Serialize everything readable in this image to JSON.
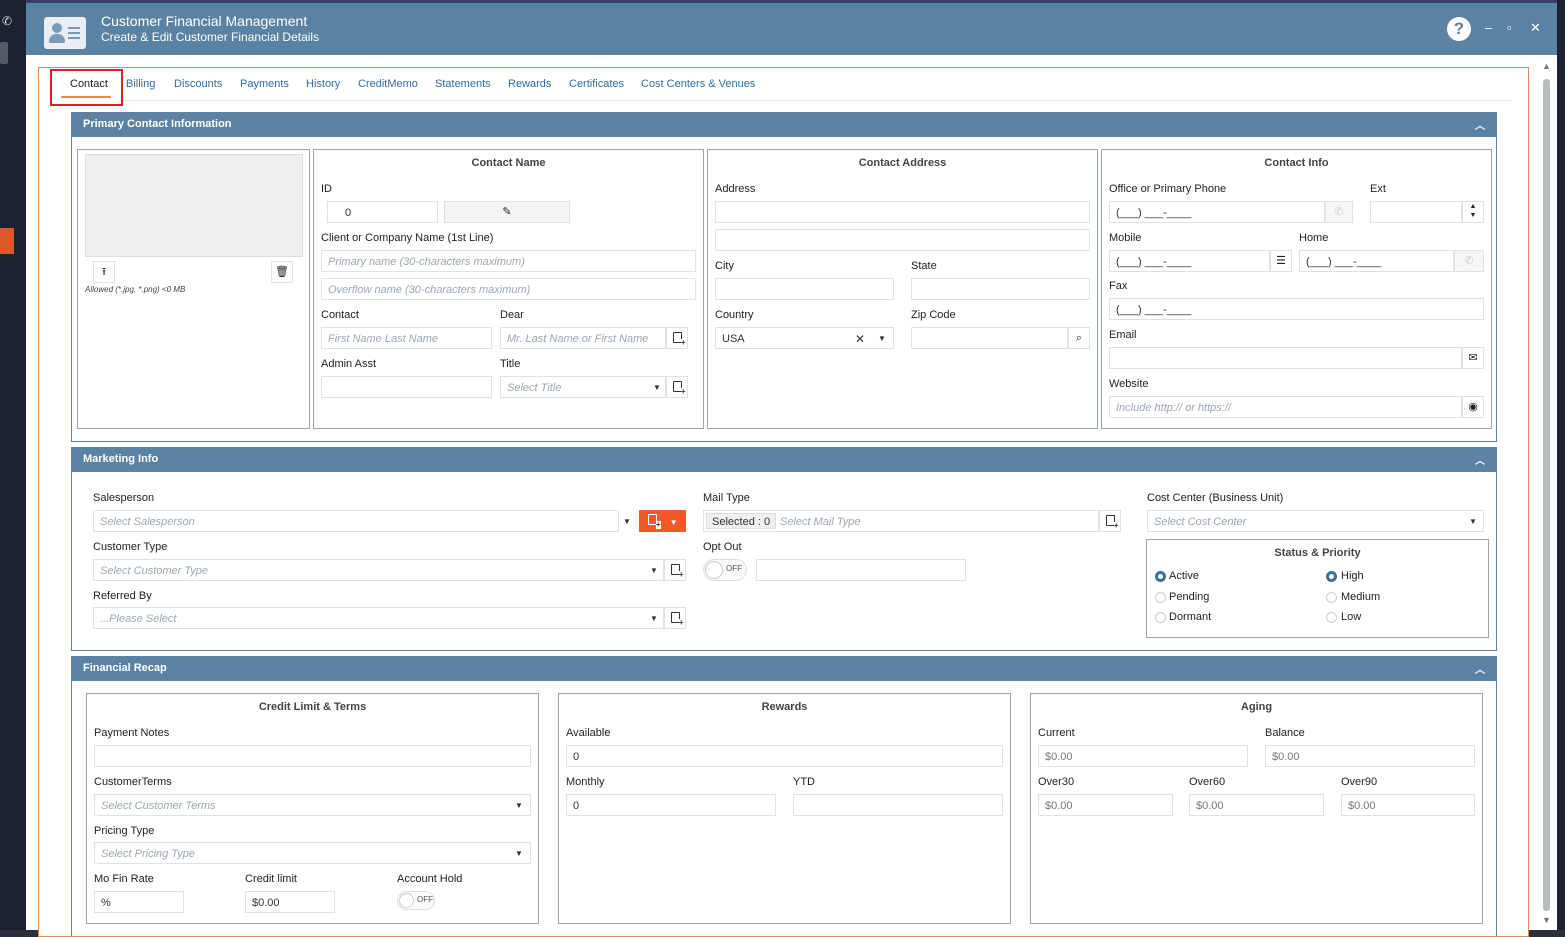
{
  "window": {
    "title": "Customer Financial Management",
    "subtitle": "Create & Edit Customer Financial Details",
    "help": "?",
    "minimize": "–",
    "maximize": "▫",
    "close": "✕"
  },
  "tabs": [
    "Contact",
    "Billing",
    "Discounts",
    "Payments",
    "History",
    "CreditMemo",
    "Statements",
    "Rewards",
    "Certificates",
    "Cost Centers & Venues"
  ],
  "primary": {
    "header": "Primary Contact Information",
    "photo_note": "Allowed (*.jpg, *.png) <0 MB",
    "contact_name": {
      "title": "Contact Name",
      "id_label": "ID",
      "id_value": "0",
      "company_label": "Client or Company Name (1st Line)",
      "primary_ph": "Primary name (30-characters maximum)",
      "overflow_ph": "Overflow name (30-characters maximum)",
      "contact_label": "Contact",
      "contact_ph": "First Name Last Name",
      "dear_label": "Dear",
      "dear_ph": "Mr. Last Name or First Name",
      "admin_label": "Admin Asst",
      "title_label": "Title",
      "title_ph": "Select Title"
    },
    "address": {
      "title": "Contact Address",
      "address_label": "Address",
      "city_label": "City",
      "state_label": "State",
      "country_label": "Country",
      "country_value": "USA",
      "zip_label": "Zip Code"
    },
    "info": {
      "title": "Contact Info",
      "phone_label": "Office or Primary Phone",
      "ext_label": "Ext",
      "phone_mask": "(___) ___-____",
      "mobile_label": "Mobile",
      "home_label": "Home",
      "fax_label": "Fax",
      "email_label": "Email",
      "website_label": "Website",
      "website_ph": "Include http:// or https://"
    }
  },
  "marketing": {
    "header": "Marketing Info",
    "salesperson_label": "Salesperson",
    "salesperson_ph": "Select Salesperson",
    "customer_type_label": "Customer Type",
    "customer_type_ph": "Select Customer Type",
    "referred_label": "Referred By",
    "referred_ph": "...Please Select",
    "mail_type_label": "Mail Type",
    "mail_selected": "Selected : 0",
    "mail_ph": "Select Mail Type",
    "opt_out_label": "Opt Out",
    "toggle_off": "OFF",
    "cost_center_label": "Cost Center (Business Unit)",
    "cost_center_ph": "Select Cost Center",
    "status_title": "Status & Priority",
    "status": [
      "Active",
      "Pending",
      "Dormant"
    ],
    "priority": [
      "High",
      "Medium",
      "Low"
    ],
    "accent_color": "#f15a24"
  },
  "financial": {
    "header": "Financial Recap",
    "credit": {
      "title": "Credit Limit & Terms",
      "payment_notes_label": "Payment Notes",
      "terms_label": "CustomerTerms",
      "terms_ph": "Select Customer Terms",
      "pricing_label": "Pricing Type",
      "pricing_ph": "Select Pricing Type",
      "mofin_label": "Mo Fin Rate",
      "mofin_value": "%",
      "limit_label": "Credit limit",
      "limit_value": "$0.00",
      "hold_label": "Account Hold",
      "hold_toggle": "OFF"
    },
    "rewards": {
      "title": "Rewards",
      "available_label": "Available",
      "available_value": "0",
      "monthly_label": "Monthly",
      "monthly_value": "0",
      "ytd_label": "YTD"
    },
    "aging": {
      "title": "Aging",
      "current_label": "Current",
      "current_value": "$0.00",
      "balance_label": "Balance",
      "balance_value": "$0.00",
      "over30_label": "Over30",
      "over30_value": "$0.00",
      "over60_label": "Over60",
      "over60_value": "$0.00",
      "over90_label": "Over90",
      "over90_value": "$0.00"
    }
  }
}
